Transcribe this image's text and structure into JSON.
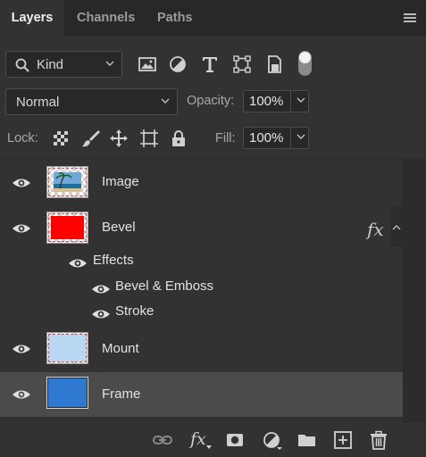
{
  "tabs": [
    {
      "label": "Layers",
      "active": true
    },
    {
      "label": "Channels",
      "active": false
    },
    {
      "label": "Paths",
      "active": false
    }
  ],
  "filter": {
    "selected": "Kind",
    "icons": [
      "image-filter-icon",
      "adjustment-filter-icon",
      "type-filter-icon",
      "shape-filter-icon",
      "smart-object-filter-icon",
      "filter-toggle"
    ]
  },
  "blend": {
    "mode": "Normal",
    "opacity_label": "Opacity:",
    "opacity": "100%"
  },
  "lock": {
    "label": "Lock:",
    "icons": [
      "lock-transparent-pixels-icon",
      "lock-image-pixels-icon",
      "lock-position-icon",
      "lock-artboard-icon",
      "lock-all-icon"
    ],
    "fill_label": "Fill:",
    "fill": "100%"
  },
  "layers": [
    {
      "name": "Image",
      "visible": true,
      "selected": false
    },
    {
      "name": "Bevel",
      "visible": true,
      "selected": false,
      "fx": "fx",
      "effects": {
        "label": "Effects",
        "items": [
          "Bevel & Emboss",
          "Stroke"
        ]
      }
    },
    {
      "name": "Mount",
      "visible": true,
      "selected": false
    },
    {
      "name": "Frame",
      "visible": true,
      "selected": true
    }
  ],
  "bottom_icons": [
    "link-layers-icon",
    "add-layer-style-icon",
    "add-mask-icon",
    "new-adjustment-layer-icon",
    "new-group-icon",
    "new-layer-icon",
    "delete-layer-icon"
  ],
  "bottom_fx_label": "fx",
  "colors": {
    "panel": "#323232",
    "tabbar": "#282828",
    "selected_row": "#4b4b4b",
    "bevel_fill": "#ff0000",
    "mount_fill": "#b9d6f2",
    "frame_fill": "#2f7ad0"
  }
}
